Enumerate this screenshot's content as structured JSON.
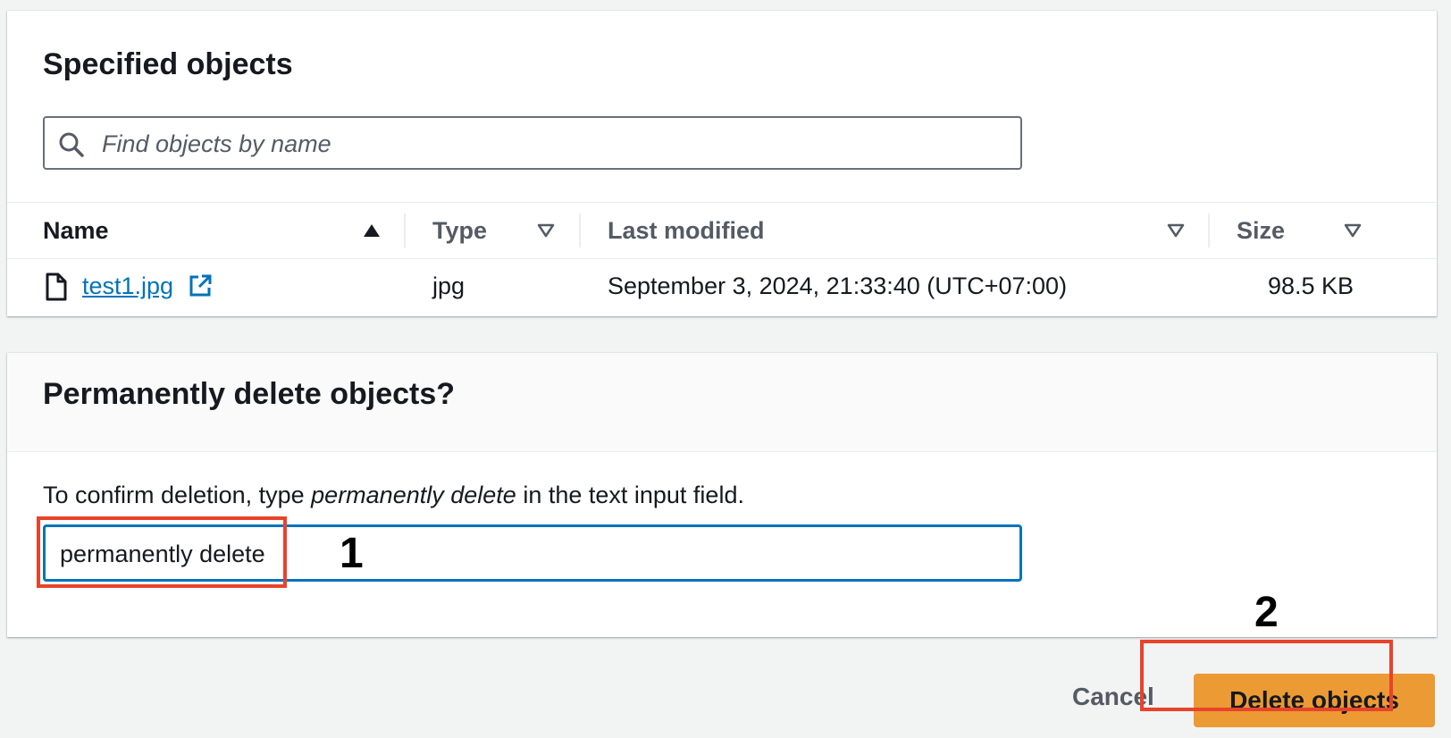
{
  "specified_objects": {
    "title": "Specified objects",
    "search": {
      "placeholder": "Find objects by name",
      "icon": "search-icon"
    },
    "columns": [
      {
        "label": "Name",
        "sort": "ascending"
      },
      {
        "label": "Type",
        "sort": "none"
      },
      {
        "label": "Last modified",
        "sort": "none"
      },
      {
        "label": "Size",
        "sort": "none"
      }
    ],
    "rows": [
      {
        "name": "test1.jpg",
        "type": "jpg",
        "last_modified": "September 3, 2024, 21:33:40 (UTC+07:00)",
        "size": "98.5 KB",
        "icons": [
          "file-icon",
          "external-link-icon"
        ]
      }
    ]
  },
  "delete_confirmation": {
    "title": "Permanently delete objects?",
    "instruction_prefix": "To confirm deletion, type ",
    "instruction_keyword": "permanently delete",
    "instruction_suffix": " in the text input field.",
    "input_value": "permanently delete"
  },
  "annotations": {
    "step1": "1",
    "step2": "2",
    "highlight_color": "#e8432b"
  },
  "actions": {
    "cancel_label": "Cancel",
    "delete_label": "Delete objects"
  },
  "colors": {
    "link": "#0073bb",
    "primary_button": "#ec9a33",
    "focus_border": "#0073bb"
  }
}
